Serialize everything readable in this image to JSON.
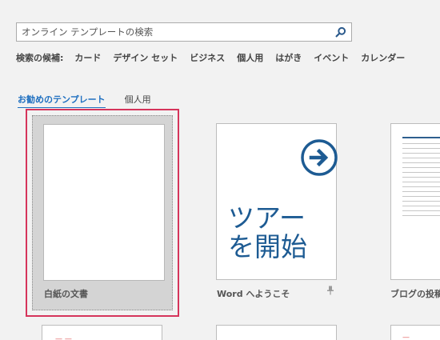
{
  "search": {
    "placeholder": "オンライン テンプレートの検索",
    "button_icon": "search-icon"
  },
  "suggestions": {
    "label": "検索の候補:",
    "items": [
      "カード",
      "デザイン セット",
      "ビジネス",
      "個人用",
      "はがき",
      "イベント",
      "カレンダー"
    ]
  },
  "tabs": [
    {
      "label": "お勧めのテンプレート",
      "active": true
    },
    {
      "label": "個人用",
      "active": false
    }
  ],
  "templates": [
    {
      "title": "白紙の文書",
      "selected": true
    },
    {
      "title": "Word へようこそ",
      "thumb_text": "ツアー\nを開始",
      "pin_icon": "pin-icon"
    },
    {
      "title": "ブログの投稿"
    }
  ],
  "colors": {
    "accent": "#1e6fc0",
    "selection": "#d6345b",
    "tour_text": "#1d5b93"
  }
}
